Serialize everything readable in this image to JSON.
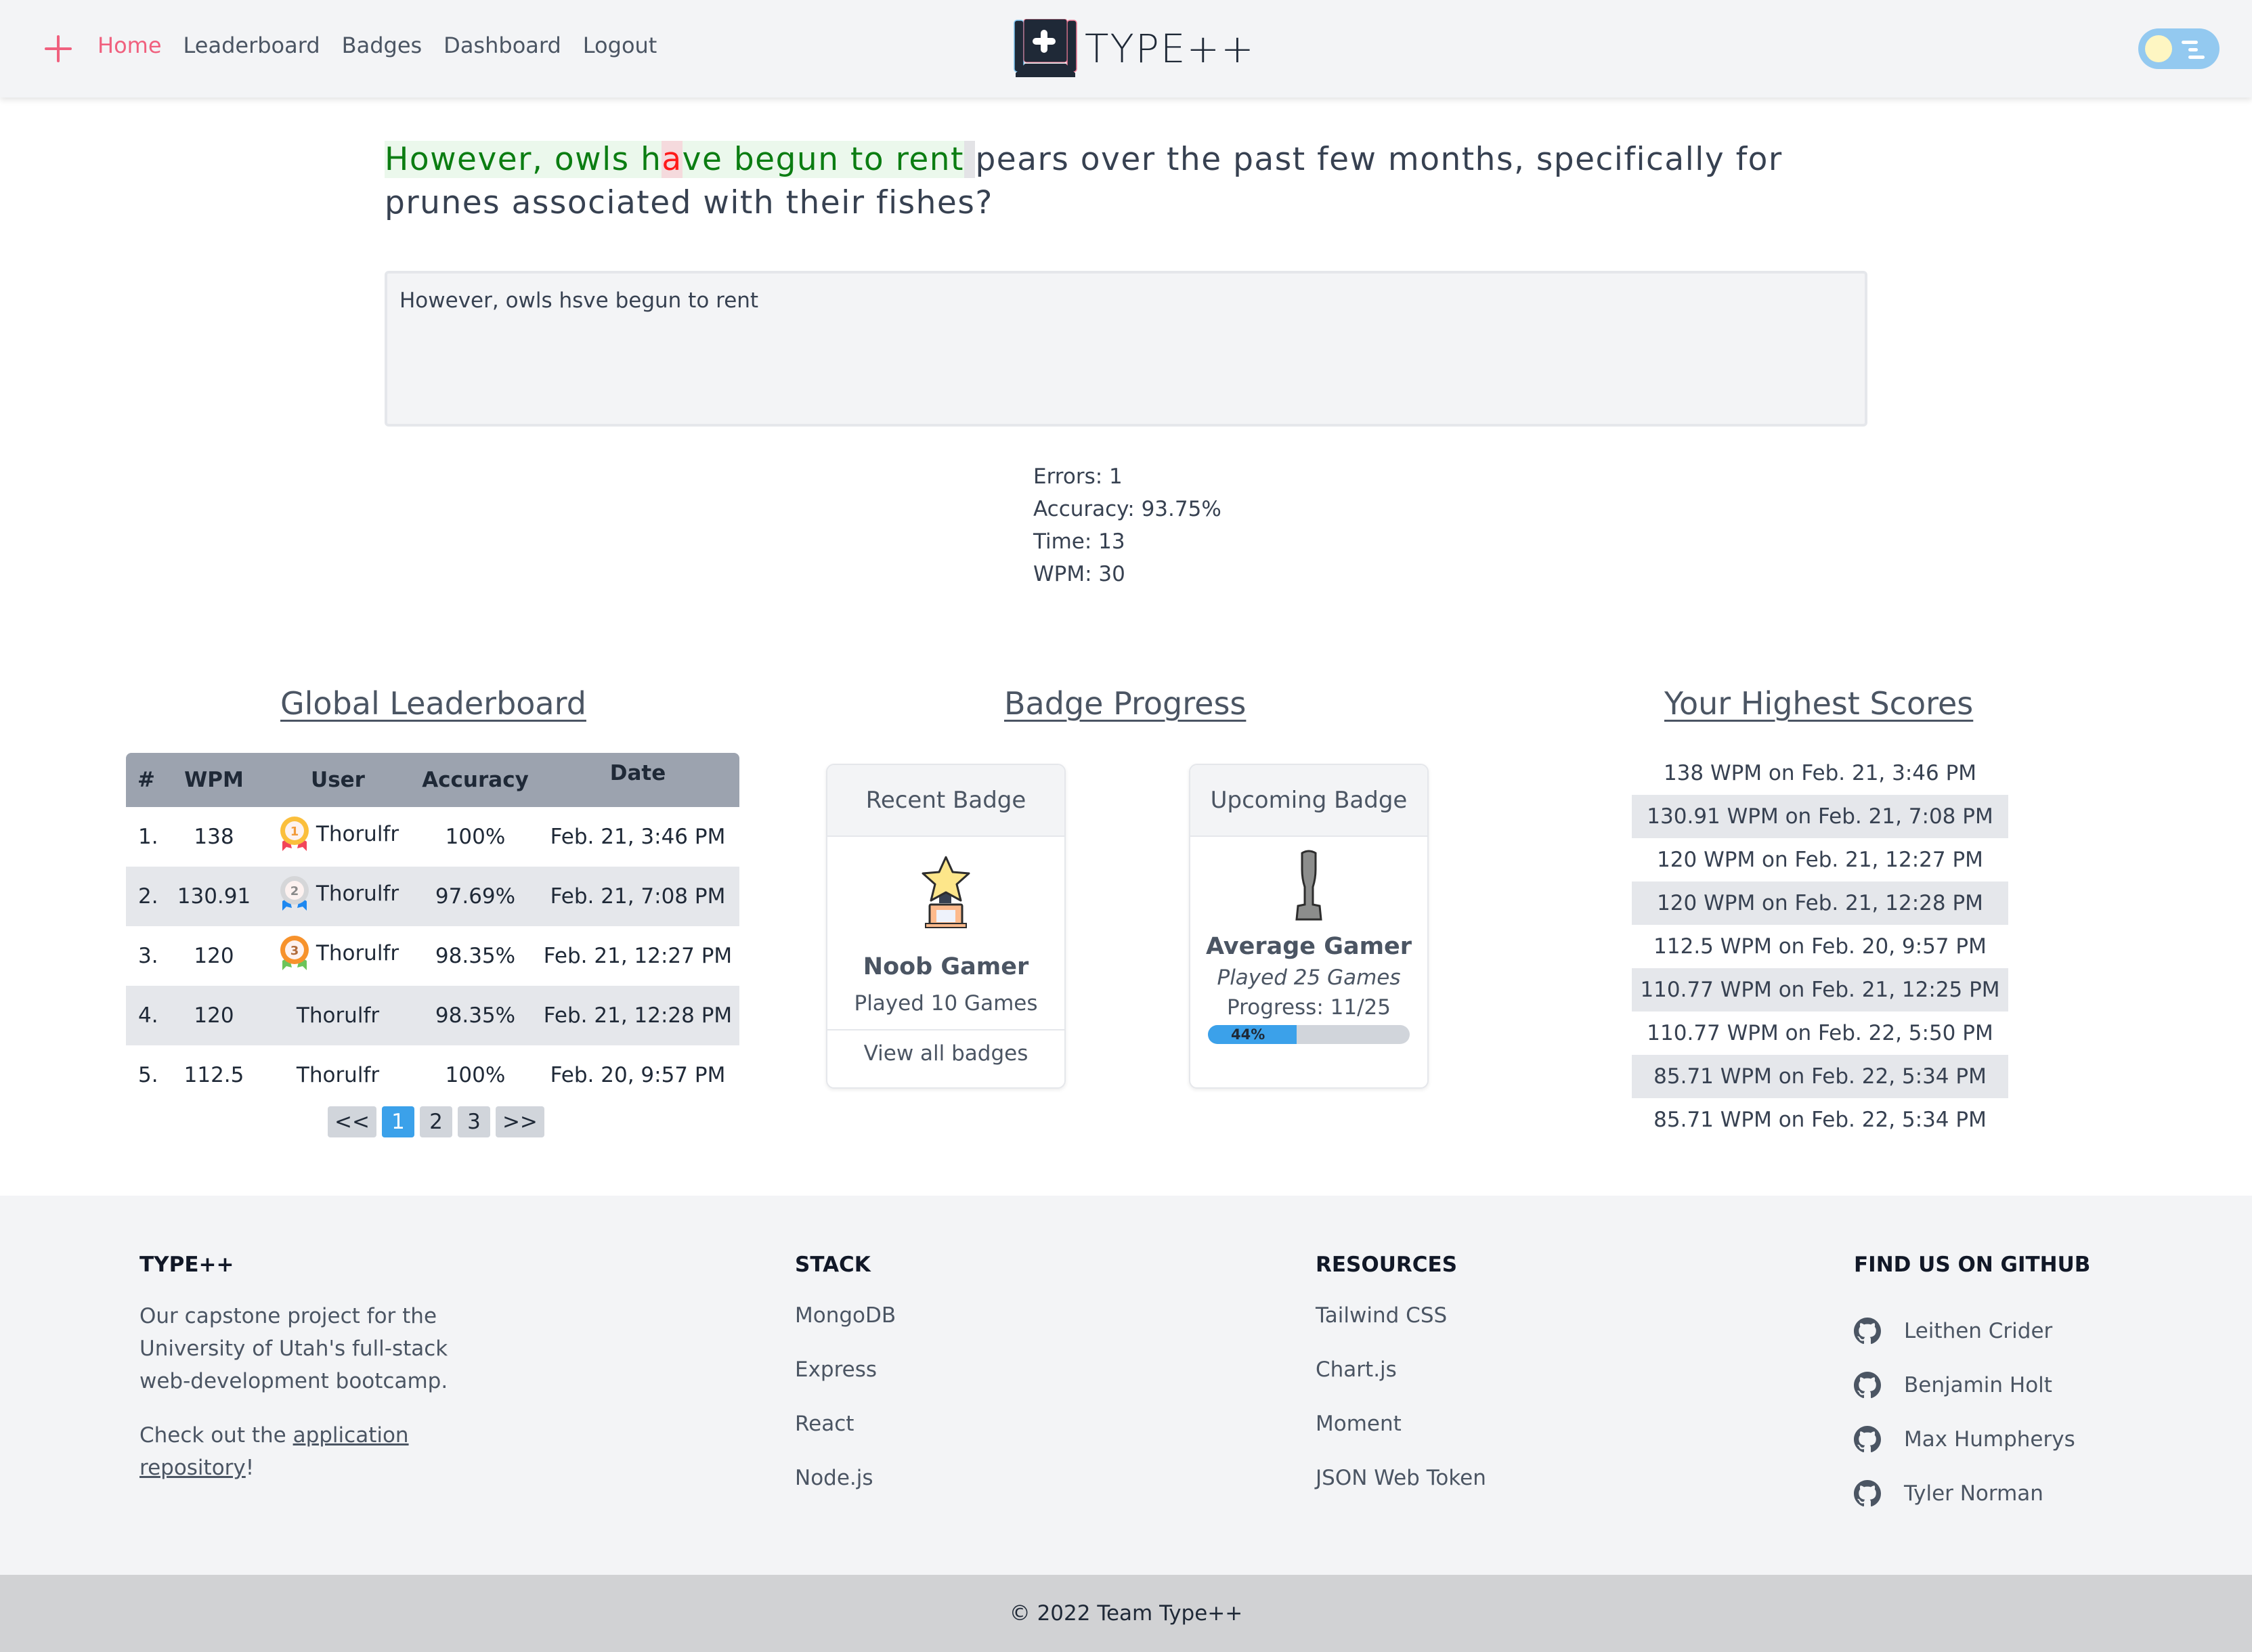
{
  "nav": {
    "links": [
      {
        "label": "Home",
        "active": true
      },
      {
        "label": "Leaderboard"
      },
      {
        "label": "Badges"
      },
      {
        "label": "Dashboard"
      },
      {
        "label": "Logout"
      }
    ],
    "logo_text": "TYPE++",
    "accent_color": "#f0607e"
  },
  "prompt": {
    "typed_before_error": "However, owls h",
    "error_char": "a",
    "typed_after_error": "ve begun to rent",
    "caret_char": " ",
    "remaining": "pears over the past few months, specifically for prunes associated with their fishes?"
  },
  "input": {
    "value": "However, owls hsve begun to rent"
  },
  "stats": {
    "errors": "Errors: 1",
    "accuracy": "Accuracy: 93.75%",
    "time": "Time: 13",
    "wpm": "WPM: 30"
  },
  "leaderboard": {
    "title": "Global Leaderboard",
    "columns": [
      "#",
      "WPM",
      "User",
      "Accuracy",
      "Date"
    ],
    "rows": [
      {
        "rank": "1.",
        "wpm": "138",
        "user": "Thorulfr",
        "accuracy": "100%",
        "date": "Feb. 21, 3:46 PM",
        "medal": "gold"
      },
      {
        "rank": "2.",
        "wpm": "130.91",
        "user": "Thorulfr",
        "accuracy": "97.69%",
        "date": "Feb. 21, 7:08 PM",
        "medal": "silver"
      },
      {
        "rank": "3.",
        "wpm": "120",
        "user": "Thorulfr",
        "accuracy": "98.35%",
        "date": "Feb. 21, 12:27 PM",
        "medal": "bronze"
      },
      {
        "rank": "4.",
        "wpm": "120",
        "user": "Thorulfr",
        "accuracy": "98.35%",
        "date": "Feb. 21, 12:28 PM",
        "medal": ""
      },
      {
        "rank": "5.",
        "wpm": "112.5",
        "user": "Thorulfr",
        "accuracy": "100%",
        "date": "Feb. 20, 9:57 PM",
        "medal": ""
      }
    ],
    "pagination": {
      "first": "<<",
      "pages": [
        "1",
        "2",
        "3"
      ],
      "current": "1",
      "last": ">>"
    }
  },
  "badges": {
    "title": "Badge Progress",
    "recent": {
      "header": "Recent Badge",
      "name": "Noob Gamer",
      "description": "Played 10 Games",
      "footer_link": "View all badges",
      "icon": "star-trophy-icon"
    },
    "upcoming": {
      "header": "Upcoming Badge",
      "name": "Average Gamer",
      "description": "Played 25 Games",
      "progress_text": "Progress: 11/25",
      "progress_percent": 44,
      "progress_label": "44%",
      "icon": "locked-trophy-icon"
    }
  },
  "highest_scores": {
    "title": "Your Highest Scores",
    "items": [
      "138 WPM on Feb. 21, 3:46 PM",
      "130.91 WPM on Feb. 21, 7:08 PM",
      "120 WPM on Feb. 21, 12:27 PM",
      "120 WPM on Feb. 21, 12:28 PM",
      "112.5 WPM on Feb. 20, 9:57 PM",
      "110.77 WPM on Feb. 21, 12:25 PM",
      "110.77 WPM on Feb. 22, 5:50 PM",
      "85.71 WPM on Feb. 22, 5:34 PM",
      "85.71 WPM on Feb. 22, 5:34 PM"
    ]
  },
  "footer": {
    "about": {
      "heading": "TYPE++",
      "description": "Our capstone project for the University of Utah's full-stack web-development bootcamp.",
      "cta_prefix": "Check out the ",
      "cta_link": "application repository",
      "cta_suffix": "!"
    },
    "stack": {
      "heading": "STACK",
      "items": [
        "MongoDB",
        "Express",
        "React",
        "Node.js"
      ]
    },
    "resources": {
      "heading": "RESOURCES",
      "items": [
        "Tailwind CSS",
        "Chart.js",
        "Moment",
        "JSON Web Token"
      ]
    },
    "github": {
      "heading": "FIND US ON GITHUB",
      "items": [
        "Leithen Crider",
        "Benjamin Holt",
        "Max Humpherys",
        "Tyler Norman"
      ]
    },
    "copyright": "© 2022 Team Type++"
  }
}
